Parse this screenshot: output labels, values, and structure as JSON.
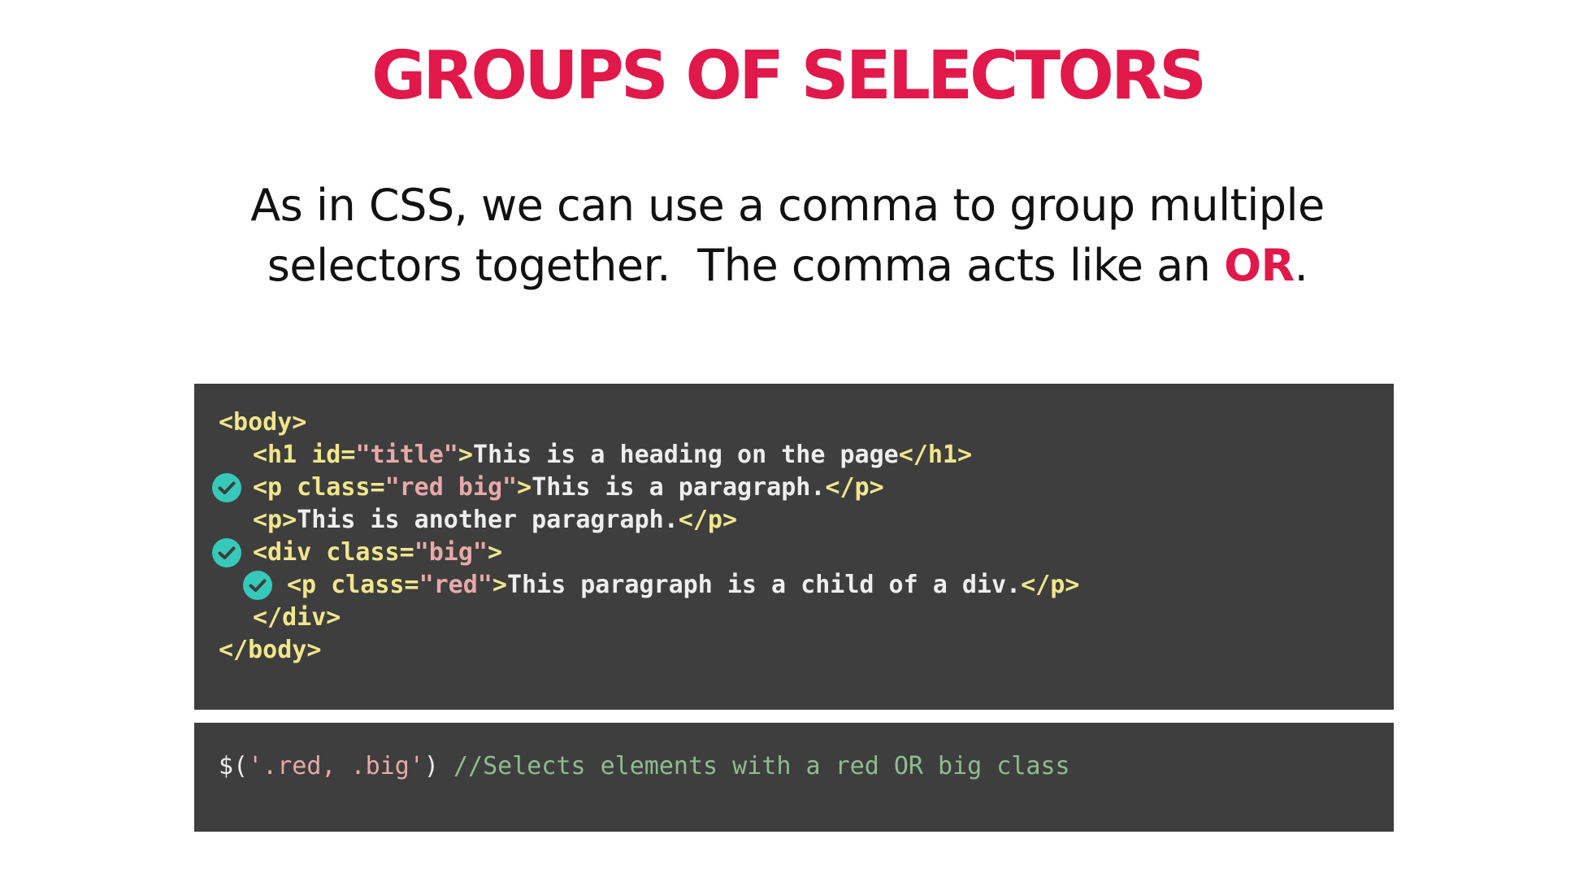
{
  "slide": {
    "title": "GROUPS OF SELECTORS",
    "subtitle_line1": "As in CSS, we can use a comma to group multiple",
    "subtitle_line2_pre": "selectors together.  The comma acts like an ",
    "subtitle_line2_emph": "OR",
    "subtitle_line2_post": "."
  },
  "colors": {
    "accent": "#e0194a",
    "code_bg": "#3e3e3e",
    "check": "#36c9b9"
  },
  "code": {
    "l1": {
      "tag": "<body>"
    },
    "l2": {
      "open": "<h1",
      "attr": " id=",
      "val": "\"title\"",
      "close": ">",
      "text": "This is a heading on the page",
      "end": "</h1>"
    },
    "l3": {
      "open": "<p",
      "attr": " class=",
      "val": "\"red big\"",
      "close": ">",
      "text": "This is a paragraph.",
      "end": "</p>"
    },
    "l4": {
      "open": "<p>",
      "text": "This is another paragraph.",
      "end": "</p>"
    },
    "l5": {
      "open": "<div",
      "attr": " class=",
      "val": "\"big\"",
      "close": ">"
    },
    "l6": {
      "open": "<p",
      "attr": " class=",
      "val": "\"red\"",
      "close": ">",
      "text": "This paragraph is a child of a div.",
      "end": "</p>"
    },
    "l7": {
      "tag": "</div>"
    },
    "l8": {
      "tag": "</body>"
    }
  },
  "query": {
    "fn_open": "$(",
    "selector": "'.red, .big'",
    "fn_close": ")",
    "comment": " //Selects elements with a red OR big class"
  },
  "icons": [
    "check-circle-icon",
    "check-circle-icon",
    "check-circle-icon"
  ]
}
